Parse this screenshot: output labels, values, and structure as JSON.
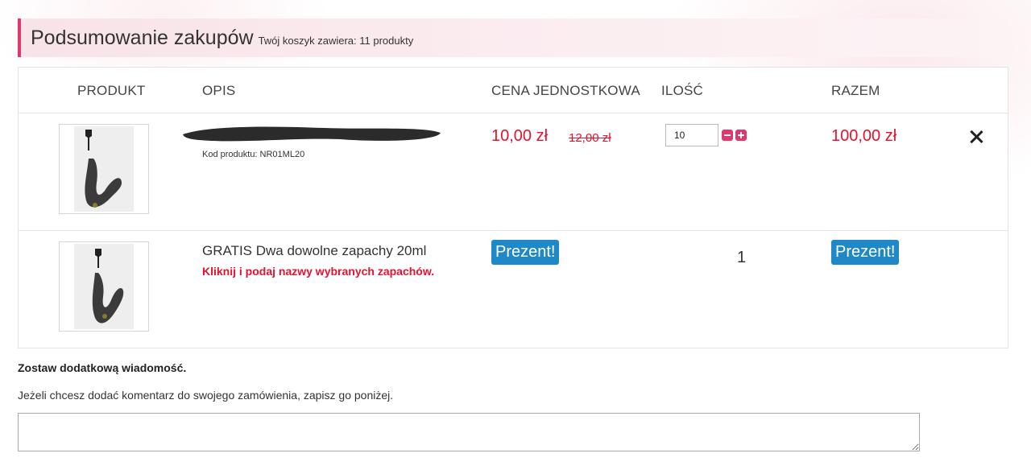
{
  "summary": {
    "title": "Podsumowanie zakupów",
    "count_text": "Twój koszyk zawiera: 11 produkty"
  },
  "table": {
    "headers": {
      "product": "PRODUKT",
      "description": "OPIS",
      "unit_price": "CENA JEDNOSTKOWA",
      "quantity": "ILOŚĆ",
      "total": "RAZEM"
    }
  },
  "items": [
    {
      "name": "",
      "code": "Kod produktu: NR01ML20",
      "price": "10,00 zł",
      "old_price": "12,00 zł",
      "quantity": "10",
      "total": "100,00 zł"
    },
    {
      "name": "GRATIS Dwa dowolne zapachy 20ml",
      "note": "Kliknij i podaj nazwy wybranych zapachów.",
      "price_badge": "Prezent!",
      "quantity": "1",
      "total_badge": "Prezent!"
    }
  ],
  "message": {
    "title": "Zostaw dodatkową wiadomość.",
    "hint": "Jeżeli chcesz dodać komentarz do swojego zamówienia, zapisz go poniżej.",
    "value": ""
  },
  "colors": {
    "accent": "#e2366e",
    "price_red": "#e8112d",
    "badge_blue": "#1e88c8"
  },
  "icons": [
    "minus-icon",
    "plus-icon",
    "close-icon"
  ]
}
